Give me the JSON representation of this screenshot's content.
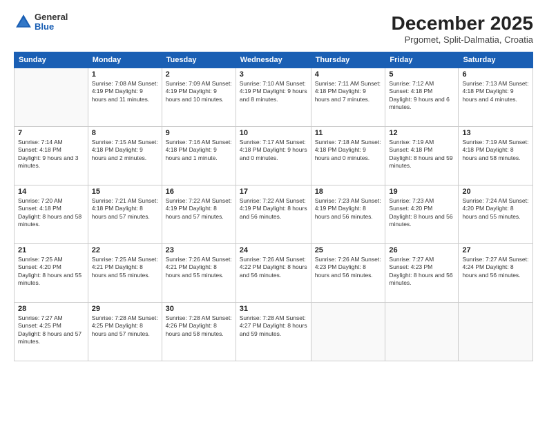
{
  "header": {
    "logo": {
      "general": "General",
      "blue": "Blue"
    },
    "title": "December 2025",
    "location": "Prgomet, Split-Dalmatia, Croatia"
  },
  "weekdays": [
    "Sunday",
    "Monday",
    "Tuesday",
    "Wednesday",
    "Thursday",
    "Friday",
    "Saturday"
  ],
  "weeks": [
    [
      {
        "day": "",
        "info": ""
      },
      {
        "day": "1",
        "info": "Sunrise: 7:08 AM\nSunset: 4:19 PM\nDaylight: 9 hours\nand 11 minutes."
      },
      {
        "day": "2",
        "info": "Sunrise: 7:09 AM\nSunset: 4:19 PM\nDaylight: 9 hours\nand 10 minutes."
      },
      {
        "day": "3",
        "info": "Sunrise: 7:10 AM\nSunset: 4:19 PM\nDaylight: 9 hours\nand 8 minutes."
      },
      {
        "day": "4",
        "info": "Sunrise: 7:11 AM\nSunset: 4:18 PM\nDaylight: 9 hours\nand 7 minutes."
      },
      {
        "day": "5",
        "info": "Sunrise: 7:12 AM\nSunset: 4:18 PM\nDaylight: 9 hours\nand 6 minutes."
      },
      {
        "day": "6",
        "info": "Sunrise: 7:13 AM\nSunset: 4:18 PM\nDaylight: 9 hours\nand 4 minutes."
      }
    ],
    [
      {
        "day": "7",
        "info": "Sunrise: 7:14 AM\nSunset: 4:18 PM\nDaylight: 9 hours\nand 3 minutes."
      },
      {
        "day": "8",
        "info": "Sunrise: 7:15 AM\nSunset: 4:18 PM\nDaylight: 9 hours\nand 2 minutes."
      },
      {
        "day": "9",
        "info": "Sunrise: 7:16 AM\nSunset: 4:18 PM\nDaylight: 9 hours\nand 1 minute."
      },
      {
        "day": "10",
        "info": "Sunrise: 7:17 AM\nSunset: 4:18 PM\nDaylight: 9 hours\nand 0 minutes."
      },
      {
        "day": "11",
        "info": "Sunrise: 7:18 AM\nSunset: 4:18 PM\nDaylight: 9 hours\nand 0 minutes."
      },
      {
        "day": "12",
        "info": "Sunrise: 7:19 AM\nSunset: 4:18 PM\nDaylight: 8 hours\nand 59 minutes."
      },
      {
        "day": "13",
        "info": "Sunrise: 7:19 AM\nSunset: 4:18 PM\nDaylight: 8 hours\nand 58 minutes."
      }
    ],
    [
      {
        "day": "14",
        "info": "Sunrise: 7:20 AM\nSunset: 4:18 PM\nDaylight: 8 hours\nand 58 minutes."
      },
      {
        "day": "15",
        "info": "Sunrise: 7:21 AM\nSunset: 4:18 PM\nDaylight: 8 hours\nand 57 minutes."
      },
      {
        "day": "16",
        "info": "Sunrise: 7:22 AM\nSunset: 4:19 PM\nDaylight: 8 hours\nand 57 minutes."
      },
      {
        "day": "17",
        "info": "Sunrise: 7:22 AM\nSunset: 4:19 PM\nDaylight: 8 hours\nand 56 minutes."
      },
      {
        "day": "18",
        "info": "Sunrise: 7:23 AM\nSunset: 4:19 PM\nDaylight: 8 hours\nand 56 minutes."
      },
      {
        "day": "19",
        "info": "Sunrise: 7:23 AM\nSunset: 4:20 PM\nDaylight: 8 hours\nand 56 minutes."
      },
      {
        "day": "20",
        "info": "Sunrise: 7:24 AM\nSunset: 4:20 PM\nDaylight: 8 hours\nand 55 minutes."
      }
    ],
    [
      {
        "day": "21",
        "info": "Sunrise: 7:25 AM\nSunset: 4:20 PM\nDaylight: 8 hours\nand 55 minutes."
      },
      {
        "day": "22",
        "info": "Sunrise: 7:25 AM\nSunset: 4:21 PM\nDaylight: 8 hours\nand 55 minutes."
      },
      {
        "day": "23",
        "info": "Sunrise: 7:26 AM\nSunset: 4:21 PM\nDaylight: 8 hours\nand 55 minutes."
      },
      {
        "day": "24",
        "info": "Sunrise: 7:26 AM\nSunset: 4:22 PM\nDaylight: 8 hours\nand 56 minutes."
      },
      {
        "day": "25",
        "info": "Sunrise: 7:26 AM\nSunset: 4:23 PM\nDaylight: 8 hours\nand 56 minutes."
      },
      {
        "day": "26",
        "info": "Sunrise: 7:27 AM\nSunset: 4:23 PM\nDaylight: 8 hours\nand 56 minutes."
      },
      {
        "day": "27",
        "info": "Sunrise: 7:27 AM\nSunset: 4:24 PM\nDaylight: 8 hours\nand 56 minutes."
      }
    ],
    [
      {
        "day": "28",
        "info": "Sunrise: 7:27 AM\nSunset: 4:25 PM\nDaylight: 8 hours\nand 57 minutes."
      },
      {
        "day": "29",
        "info": "Sunrise: 7:28 AM\nSunset: 4:25 PM\nDaylight: 8 hours\nand 57 minutes."
      },
      {
        "day": "30",
        "info": "Sunrise: 7:28 AM\nSunset: 4:26 PM\nDaylight: 8 hours\nand 58 minutes."
      },
      {
        "day": "31",
        "info": "Sunrise: 7:28 AM\nSunset: 4:27 PM\nDaylight: 8 hours\nand 59 minutes."
      },
      {
        "day": "",
        "info": ""
      },
      {
        "day": "",
        "info": ""
      },
      {
        "day": "",
        "info": ""
      }
    ]
  ]
}
